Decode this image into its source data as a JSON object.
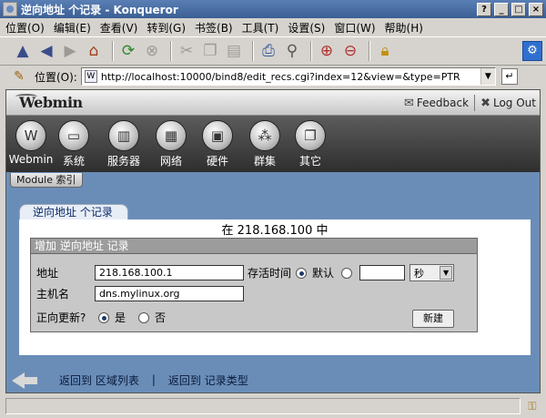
{
  "window": {
    "title": "逆向地址 个记录 - Konqueror",
    "controls": [
      "?",
      "_",
      "□",
      "×"
    ]
  },
  "menu": [
    "位置(O)",
    "编辑(E)",
    "查看(V)",
    "转到(G)",
    "书签(B)",
    "工具(T)",
    "设置(S)",
    "窗口(W)",
    "帮助(H)"
  ],
  "toolbar": {
    "icons": [
      "up-icon",
      "back-icon",
      "forward-icon",
      "home-icon",
      "reload-icon",
      "stop-icon",
      "cut-icon",
      "copy-icon",
      "paste-icon",
      "print-icon",
      "find-icon",
      "zoom-in-icon",
      "zoom-out-icon",
      "lock-icon",
      "settings-icon"
    ]
  },
  "location": {
    "label": "位置(O):",
    "url": "http://localhost:10000/bind8/edit_recs.cgi?index=12&view=&type=PTR"
  },
  "webmin": {
    "logo": "Webmin",
    "feedback": "Feedback",
    "logout": "Log Out",
    "categories": [
      {
        "label": "Webmin",
        "icon": "webmin-icon"
      },
      {
        "label": "系统",
        "icon": "system-icon"
      },
      {
        "label": "服务器",
        "icon": "servers-icon"
      },
      {
        "label": "网络",
        "icon": "network-icon"
      },
      {
        "label": "硬件",
        "icon": "hardware-icon"
      },
      {
        "label": "群集",
        "icon": "cluster-icon"
      },
      {
        "label": "其它",
        "icon": "others-icon"
      }
    ],
    "module_index": "Module 索引"
  },
  "page": {
    "tab_title": "逆向地址 个记录",
    "heading": "在 218.168.100 中",
    "form_title": "增加 逆向地址 记录",
    "address_label": "地址",
    "address_value": "218.168.100.1",
    "ttl_label": "存活时间",
    "ttl_default_label": "默认",
    "ttl_value": "",
    "ttl_unit": "秒",
    "hostname_label": "主机名",
    "hostname_value": "dns.mylinux.org",
    "update_forward_label": "正向更新?",
    "yes_label": "是",
    "no_label": "否",
    "create_button": "新建"
  },
  "footer": {
    "back_zone_list": "返回到 区域列表",
    "separator": "|",
    "back_record_types": "返回到 记录类型"
  }
}
